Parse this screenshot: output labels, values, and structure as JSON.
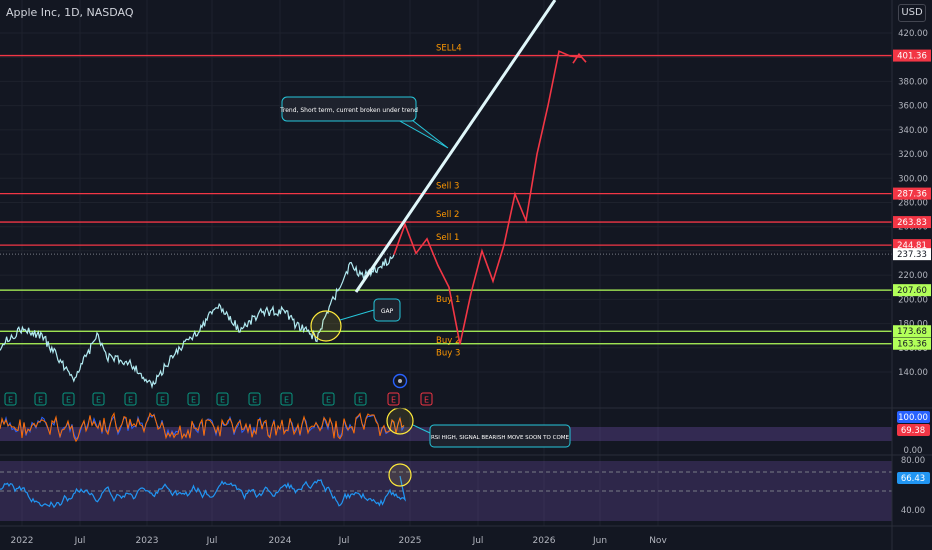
{
  "header": {
    "symbol": "Apple Inc, 1D, NASDAQ",
    "currency": "USD"
  },
  "price_axis_ticks": [
    "420.00",
    "400.00",
    "380.00",
    "360.00",
    "340.00",
    "320.00",
    "300.00",
    "280.00",
    "260.00",
    "240.00",
    "220.00",
    "200.00",
    "180.00",
    "160.00",
    "140.00"
  ],
  "levels": [
    {
      "label": "SELL4",
      "value": 401.36,
      "value_label": "401.36",
      "color": "#f23645"
    },
    {
      "label": "Sell 3",
      "value": 287.36,
      "value_label": "287.36",
      "color": "#f23645"
    },
    {
      "label": "Sell 2",
      "value": 263.83,
      "value_label": "263.83",
      "color": "#f23645"
    },
    {
      "label": "Sell 1",
      "value": 244.81,
      "value_label": "244.81",
      "color": "#f23645"
    },
    {
      "label": "Buy 1",
      "value": 207.6,
      "value_label": "207.60",
      "color": "#b2ff59"
    },
    {
      "label": "Buy 2",
      "value": 173.68,
      "value_label": "173.68",
      "color": "#b2ff59"
    },
    {
      "label": "Buy 3",
      "value": 163.36,
      "value_label": "163.36",
      "color": "#b2ff59"
    }
  ],
  "last_price": "237.33",
  "annotations": {
    "trend": "Trend, Short term, current broken under trend",
    "gap": "GAP",
    "rsi": "RSI HIGH, SIGNAL BEARISH MOVE SOON TO COME"
  },
  "earnings_marker": "E",
  "stoch": {
    "top_label": "100.00",
    "value_label": "69.38",
    "bottom_label": "0.00"
  },
  "rsi": {
    "top_label": "80.00",
    "value_label": "66.43",
    "bottom_label": "40.00"
  },
  "time_labels": [
    "2022",
    "Jul",
    "2023",
    "Jul",
    "2024",
    "Jul",
    "2025",
    "Jul",
    "2026",
    "Jun",
    "Nov"
  ],
  "chart_data": {
    "type": "line",
    "title": "Apple Inc, 1D, NASDAQ",
    "xlabel": "",
    "ylabel": "",
    "ylim": [
      120,
      430
    ],
    "series": [
      {
        "x": [
          "2021-11",
          "2022-01",
          "2022-03",
          "2022-05",
          "2022-06",
          "2022-08",
          "2022-09",
          "2022-11",
          "2023-01",
          "2023-03",
          "2023-05",
          "2023-07",
          "2023-09",
          "2023-11",
          "2024-01",
          "2024-02",
          "2024-04",
          "2024-05",
          "2024-06",
          "2024-07",
          "2024-08",
          "2024-10",
          "2024-11"
        ],
        "values": [
          160,
          175,
          170,
          145,
          135,
          170,
          152,
          148,
          128,
          155,
          172,
          195,
          175,
          190,
          190,
          180,
          168,
          190,
          210,
          228,
          220,
          228,
          237
        ]
      },
      {
        "x": [
          "2024-11",
          "2024-12",
          "2025-01",
          "2025-02",
          "2025-03",
          "2025-04",
          "2025-05",
          "2025-06",
          "2025-07",
          "2025-08",
          "2025-09",
          "2025-10",
          "2025-11",
          "2025-12",
          "2026-01",
          "2026-02",
          "2026-03",
          "2026-04"
        ],
        "values": [
          237,
          262,
          238,
          250,
          228,
          210,
          163,
          205,
          240,
          215,
          245,
          287,
          265,
          320,
          360,
          405,
          401,
          400
        ]
      }
    ]
  }
}
